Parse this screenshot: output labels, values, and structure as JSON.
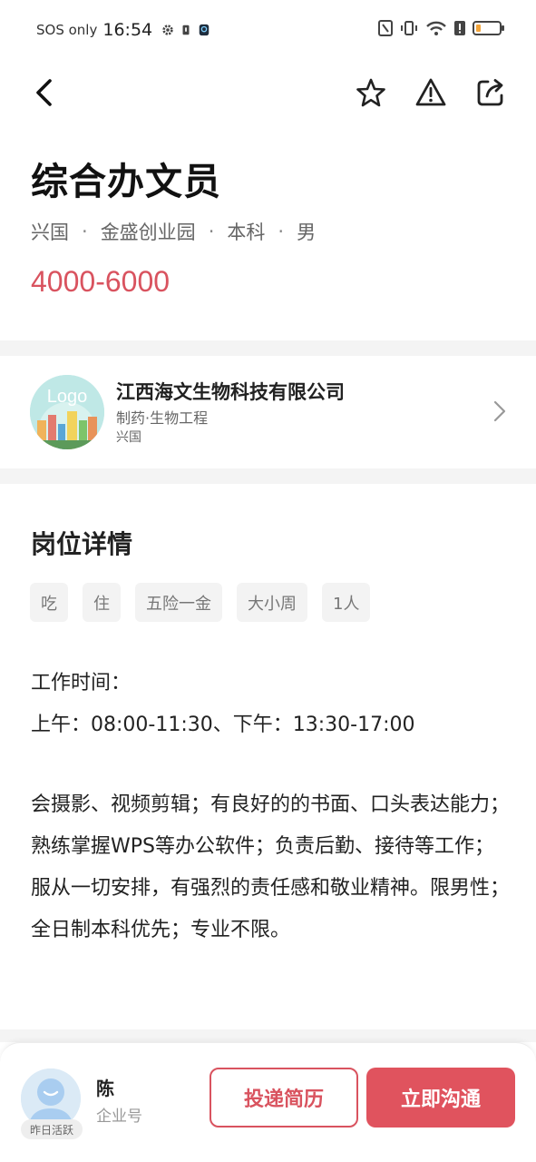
{
  "status_bar": {
    "carrier": "SOS only",
    "time": "16:54",
    "battery_level": 0.2
  },
  "toolbar": {
    "back_icon": "chevron-left-icon",
    "favorite_icon": "star-icon",
    "report_icon": "warning-icon",
    "share_icon": "share-icon"
  },
  "job": {
    "title": "综合办文员",
    "meta": [
      "兴国",
      "金盛创业园",
      "本科",
      "男"
    ],
    "meta_separator": "·",
    "salary": "4000-6000"
  },
  "company": {
    "logo_text": "Logo",
    "name": "江西海文生物科技有限公司",
    "industry": "制药·生物工程",
    "city": "兴国"
  },
  "details": {
    "section_title": "岗位详情",
    "tags": [
      "吃",
      "住",
      "五险一金",
      "大小周",
      "1人"
    ],
    "work_time_label": "工作时间：",
    "work_time_value": "上午：08:00-11:30、下午：13:30-17:00",
    "description": "会摄影、视频剪辑；有良好的的书面、口头表达能力；熟练掌握WPS等办公软件；负责后勤、接待等工作；服从一切安排，有强烈的责任感和敬业精神。限男性；全日制本科优先；专业不限。"
  },
  "bottom_bar": {
    "recruiter_name": "陈",
    "recruiter_role": "企业号",
    "active_status": "昨日活跃",
    "resume_button": "投递简历",
    "chat_button": "立即沟通"
  },
  "colors": {
    "accent": "#e0535e",
    "salary": "#d9535f"
  }
}
